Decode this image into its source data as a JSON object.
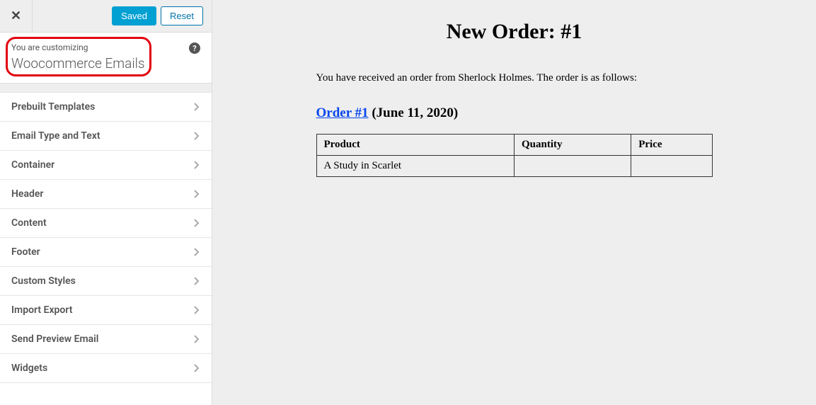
{
  "topbar": {
    "saved_label": "Saved",
    "reset_label": "Reset"
  },
  "heading": {
    "small": "You are customizing",
    "large": "Woocommerce Emails"
  },
  "menu": [
    {
      "label": "Prebuilt Templates"
    },
    {
      "label": "Email Type and Text"
    },
    {
      "label": "Container"
    },
    {
      "label": "Header"
    },
    {
      "label": "Content"
    },
    {
      "label": "Footer"
    },
    {
      "label": "Custom Styles"
    },
    {
      "label": "Import Export"
    },
    {
      "label": "Send Preview Email"
    },
    {
      "label": "Widgets"
    }
  ],
  "preview": {
    "title": "New Order: #1",
    "description": "You have received an order from Sherlock Holmes. The order is as follows:",
    "order_link": "Order #1",
    "order_date": " (June 11, 2020)",
    "table": {
      "headers": {
        "product": "Product",
        "quantity": "Quantity",
        "price": "Price"
      },
      "rows": [
        {
          "product": "A Study in Scarlet",
          "quantity": "",
          "price": ""
        }
      ]
    }
  }
}
